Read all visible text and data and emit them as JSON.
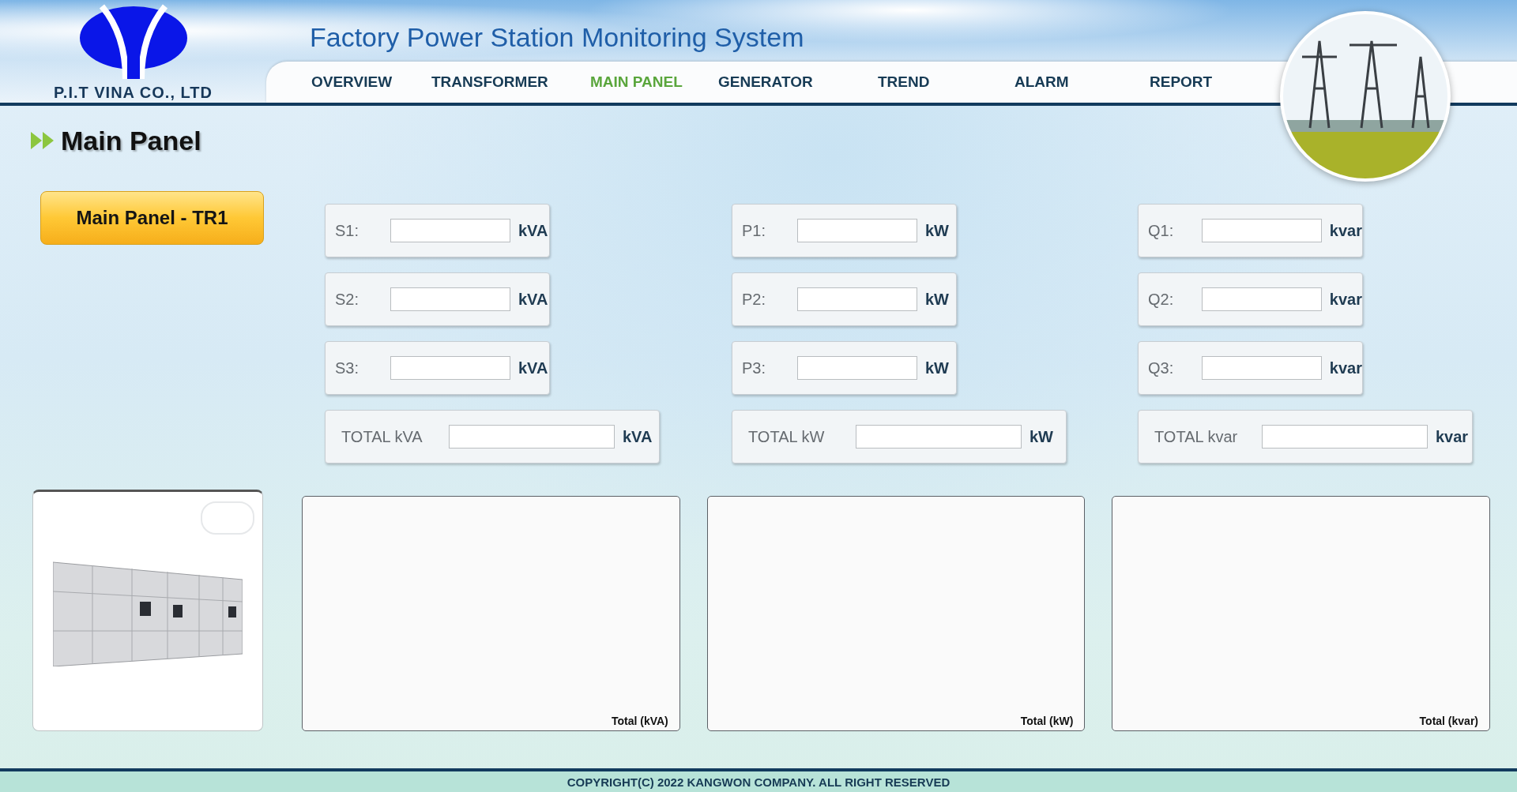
{
  "header": {
    "company": "P.I.T VINA CO., LTD",
    "title": "Factory Power Station Monitoring System"
  },
  "nav": [
    {
      "label": "OVERVIEW",
      "selected": false
    },
    {
      "label": "TRANSFORMER",
      "selected": false
    },
    {
      "label": "MAIN PANEL",
      "selected": true
    },
    {
      "label": "GENERATOR",
      "selected": false
    },
    {
      "label": "TREND",
      "selected": false
    },
    {
      "label": "ALARM",
      "selected": false
    },
    {
      "label": "REPORT",
      "selected": false
    }
  ],
  "page_title": "Main Panel",
  "panel_button": "Main Panel - TR1",
  "groups": [
    {
      "fields": [
        {
          "label": "S1:",
          "unit": "kVA"
        },
        {
          "label": "S2:",
          "unit": "kVA"
        },
        {
          "label": "S3:",
          "unit": "kVA"
        }
      ],
      "total": {
        "label": "TOTAL kVA",
        "unit": "kVA"
      }
    },
    {
      "fields": [
        {
          "label": "P1:",
          "unit": "kW"
        },
        {
          "label": "P2:",
          "unit": "kW"
        },
        {
          "label": "P3:",
          "unit": "kW"
        }
      ],
      "total": {
        "label": "TOTAL kW",
        "unit": "kW"
      }
    },
    {
      "fields": [
        {
          "label": "Q1:",
          "unit": "kvar"
        },
        {
          "label": "Q2:",
          "unit": "kvar"
        },
        {
          "label": "Q3:",
          "unit": "kvar"
        }
      ],
      "total": {
        "label": "TOTAL kvar",
        "unit": "kvar"
      }
    }
  ],
  "charts": [
    {
      "caption": "Total (kVA)"
    },
    {
      "caption": "Total (kW)"
    },
    {
      "caption": "Total (kvar)"
    }
  ],
  "footer": "COPYRIGHT(C) 2022 KANGWON COMPANY. ALL RIGHT RESERVED"
}
